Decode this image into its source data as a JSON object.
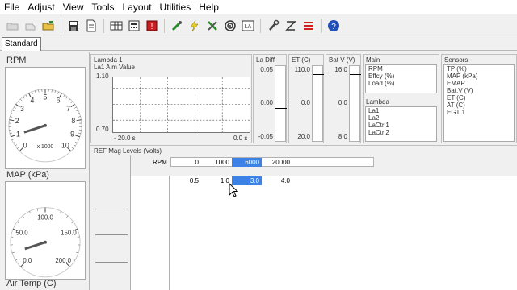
{
  "menu": [
    "File",
    "Adjust",
    "View",
    "Tools",
    "Layout",
    "Utilities",
    "Help"
  ],
  "toolbar_icons": [
    "open-folder-icon",
    "back-icon",
    "folder-up-icon",
    "save-icon",
    "document-icon",
    "table-icon",
    "calculator-icon",
    "alert-icon",
    "wrench-green-icon",
    "lightning-icon",
    "tools-icon",
    "target-icon",
    "la-icon",
    "wrench-icon",
    "z-icon",
    "red-bars-icon",
    "help-icon"
  ],
  "tab": {
    "label": "Standard"
  },
  "gauges": {
    "rpm": {
      "title": "RPM",
      "ticks": [
        "0",
        "1",
        "2",
        "3",
        "4",
        "5",
        "6",
        "7",
        "8",
        "9",
        "10"
      ],
      "multiplier": "x 1000",
      "value": 1.0
    },
    "map": {
      "title": "MAP (kPa)",
      "ticks": [
        "0.0",
        "50.0",
        "100.0",
        "150.0",
        "200.0"
      ],
      "value": 20
    },
    "air": {
      "title": "Air Temp (C)"
    }
  },
  "lambda_panel": {
    "title": "Lambda 1",
    "subtitle": "La1 Aim Value",
    "y_max": "1.10",
    "y_min": "0.70",
    "x_left": "- 20.0 s",
    "x_right": "0.0 s"
  },
  "vbars": [
    {
      "title": "La Diff",
      "top": "0.05",
      "mid": "0.00",
      "bottom": "-0.05"
    },
    {
      "title": "ET (C)",
      "top": "110.0",
      "mid": "0.0",
      "bottom": "20.0"
    },
    {
      "title": "Bat V (V)",
      "top": "16.0",
      "mid": "0.0",
      "bottom": "8.0"
    }
  ],
  "main_group": {
    "title": "Main",
    "items": [
      "RPM",
      "Effcy (%)",
      "Load (%)"
    ]
  },
  "lambda_group": {
    "title": "Lambda",
    "items": [
      "La1",
      "La2",
      "LaCtrl1",
      "LaCtrl2"
    ]
  },
  "sensors_group": {
    "title": "Sensors",
    "items": [
      "TP (%)",
      "MAP (kPa)",
      "EMAP",
      "Bat.V (V)",
      "ET (C)",
      "AT (C)",
      "EGT 1"
    ]
  },
  "ref_table": {
    "title": "REF Mag Levels (Volts)",
    "row_label": "RPM",
    "rpm_values": [
      "0",
      "1000",
      "6000",
      "20000"
    ],
    "volt_values": [
      "0.5",
      "1.0",
      "3.0",
      "4.0"
    ],
    "selected_index": 2
  },
  "colors": {
    "selection": "#3c82e6"
  }
}
